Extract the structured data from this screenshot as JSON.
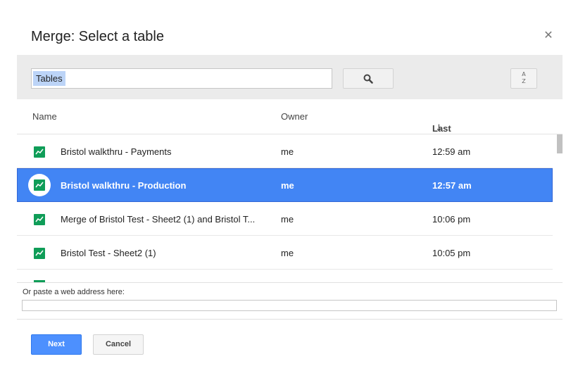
{
  "dialog": {
    "title": "Merge: Select a table",
    "close_icon": "close-icon"
  },
  "toolbar": {
    "search_value": "Tables",
    "search_icon": "search-icon",
    "sort_icon": "sort-az-icon",
    "sort_icon_top": "A",
    "sort_icon_bottom": "Z"
  },
  "columns": {
    "name": "Name",
    "owner": "Owner",
    "last_modified": "Last modified",
    "sort_arrow": "↓"
  },
  "rows": [
    {
      "name": "Bristol walkthru - Payments",
      "owner": "me",
      "modified": "12:59 am",
      "selected": false
    },
    {
      "name": "Bristol walkthru - Production",
      "owner": "me",
      "modified": "12:57 am",
      "selected": true
    },
    {
      "name": "Merge of Bristol Test - Sheet2 (1) and Bristol T...",
      "owner": "me",
      "modified": "10:06 pm",
      "selected": false
    },
    {
      "name": "Bristol Test - Sheet2 (1)",
      "owner": "me",
      "modified": "10:05 pm",
      "selected": false
    }
  ],
  "paste": {
    "label": "Or paste a web address here:",
    "value": ""
  },
  "buttons": {
    "next": "Next",
    "cancel": "Cancel"
  },
  "colors": {
    "accent": "#4285f4",
    "table_icon": "#0f9d58"
  }
}
